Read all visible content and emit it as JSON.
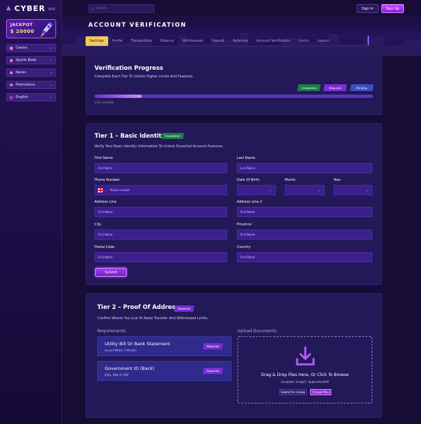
{
  "brand": {
    "name": "CYBER",
    "suffix": "WIN"
  },
  "jackpot": {
    "label": "JACKPOT",
    "value": "$ 20000"
  },
  "sidebar": {
    "items": [
      {
        "label": "Casino",
        "icon": "dice-icon"
      },
      {
        "label": "Sports Book",
        "icon": "ball-icon"
      },
      {
        "label": "Races",
        "icon": "shield-icon"
      },
      {
        "label": "Promotions",
        "icon": "heart-icon"
      },
      {
        "label": "English",
        "icon": "globe-icon"
      }
    ]
  },
  "header": {
    "search_placeholder": "Search...",
    "signin_label": "Sign In",
    "signup_label": "Sign Up"
  },
  "page": {
    "title": "ACCOUNT VERIFICATION"
  },
  "tabs": [
    "Settings",
    "Profile",
    "Transactions",
    "Balance",
    "Withdrawals",
    "Deposit",
    "Referrals",
    "Account Verification",
    "Limits",
    "Logout"
  ],
  "progress": {
    "title": "Verification Progress",
    "subtitle": "Complete Each Tier To Unlock Higher Limits And Features.",
    "legend": {
      "completed": "Completed",
      "required": "Required",
      "pending": "Pending"
    },
    "percent": 0.17,
    "text": "xx% complete"
  },
  "tier1": {
    "title": "Tier 1 – Basic Identity",
    "badge": "Completed",
    "subtitle": "Verify Your Basic Identity Information To Unlock Essential Account Features.",
    "first_name": {
      "label": "First Name",
      "placeholder": "First Name"
    },
    "last_name": {
      "label": "Last Name",
      "placeholder": "Last Name"
    },
    "phone": {
      "label": "Phone Number",
      "placeholder": "Phone number"
    },
    "dob": {
      "label": "Date Of Birth",
      "month_label": "Month",
      "year_label": "Year",
      "day_value": "-",
      "month_value": "-",
      "year_value": "-"
    },
    "address1": {
      "label": "Address Line",
      "placeholder": "First Name"
    },
    "address2": {
      "label": "Address Line 2",
      "placeholder": "First Name"
    },
    "city": {
      "label": "City",
      "placeholder": "First Name"
    },
    "province": {
      "label": "Province",
      "placeholder": "First Name"
    },
    "postal": {
      "label": "Postal Code",
      "placeholder": "First Name"
    },
    "country": {
      "label": "Country",
      "placeholder": "First Name"
    },
    "submit_label": "Submit"
  },
  "tier2": {
    "title": "Tier 2 – Proof Of Address",
    "badge": "Required",
    "subtitle": "Confirm Where You Live To Raise Transfer And Withdrawal Limits.",
    "requirements_heading": "Requirements",
    "upload_heading": "Upload Documents",
    "requirements": [
      {
        "title": "Utility Bill Or Bank Statement",
        "sub": "Issued Within 3 Months",
        "badge": "Required"
      },
      {
        "title": "Government ID (Back)",
        "sub": "JPEG, PNG Or PDF",
        "badge": "Required"
      }
    ],
    "upload": {
      "title": "Drag & Drop Files Here, Or Click To Browse",
      "sub": "Accepted: Image/*, Application/Pdf",
      "submit_label": "Submit for review",
      "choose_label": "Choose files"
    }
  },
  "colors": {
    "accent": "#b15cff",
    "completed": "#1f7a4a",
    "required": "#7a2fd6",
    "pending": "#3a4fc4",
    "active_tab": "#f2c95b"
  }
}
